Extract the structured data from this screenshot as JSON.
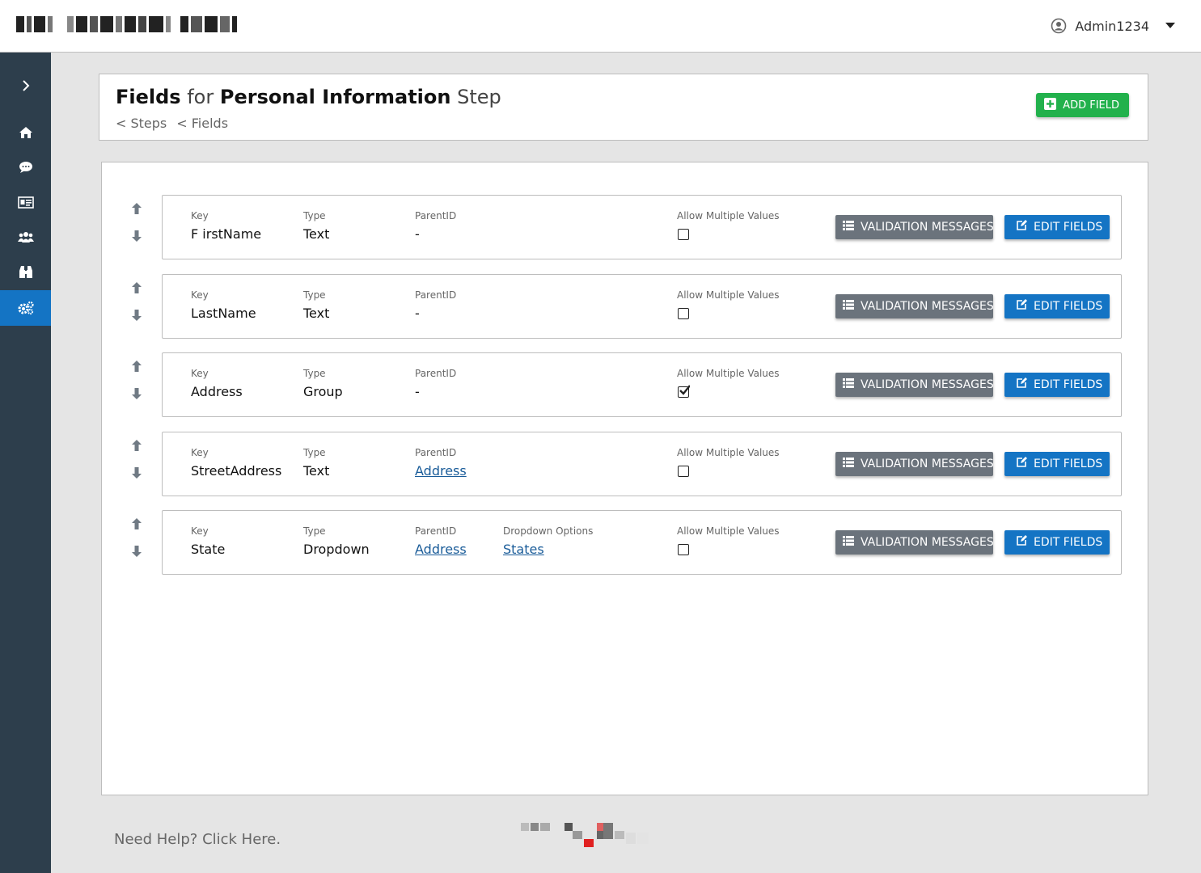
{
  "header": {
    "user_name": "Admin1234"
  },
  "page": {
    "title_fields": "Fields",
    "title_for": "for",
    "title_step_name": "Personal Information",
    "title_step": "Step",
    "breadcrumb_steps": "< Steps",
    "breadcrumb_fields": "< Fields",
    "add_field_label": "ADD FIELD"
  },
  "labels": {
    "key": "Key",
    "type": "Type",
    "parent_id": "ParentID",
    "dropdown_options": "Dropdown Options",
    "allow_multiple": "Allow Multiple Values",
    "validation_messages": "VALIDATION MESSAGES",
    "edit_fields": "EDIT FIELDS"
  },
  "fields": [
    {
      "key": "F irstName",
      "type": "Text",
      "parent_id": "-",
      "parent_is_link": false,
      "dropdown_options": null,
      "allow_multiple": false
    },
    {
      "key": "LastName",
      "type": "Text",
      "parent_id": "-",
      "parent_is_link": false,
      "dropdown_options": null,
      "allow_multiple": false
    },
    {
      "key": "Address",
      "type": "Group",
      "parent_id": "-",
      "parent_is_link": false,
      "dropdown_options": null,
      "allow_multiple": true
    },
    {
      "key": "StreetAddress",
      "type": "Text",
      "parent_id": "Address",
      "parent_is_link": true,
      "dropdown_options": null,
      "allow_multiple": false
    },
    {
      "key": "State",
      "type": "Dropdown",
      "parent_id": "Address",
      "parent_is_link": true,
      "dropdown_options": "States",
      "allow_multiple": false
    }
  ],
  "footer": {
    "help_text": "Need Help? Click Here."
  },
  "colors": {
    "sidebar_bg": "#2d3e4c",
    "sidebar_active": "#1474c4",
    "add_button": "#22b14c",
    "validation_button": "#6b737c",
    "edit_button": "#1474c4",
    "link": "#1a5c99"
  },
  "icons": {
    "sidebar": [
      "chevron-right-icon",
      "home-icon",
      "chat-icon",
      "id-card-icon",
      "users-icon",
      "binoculars-icon",
      "gears-icon"
    ],
    "user": "user-circle-icon",
    "dropdown": "caret-down-icon",
    "add": "plus-square-icon",
    "validation": "list-icon",
    "edit": "edit-icon",
    "move_up": "arrow-up-icon",
    "move_down": "arrow-down-icon"
  }
}
